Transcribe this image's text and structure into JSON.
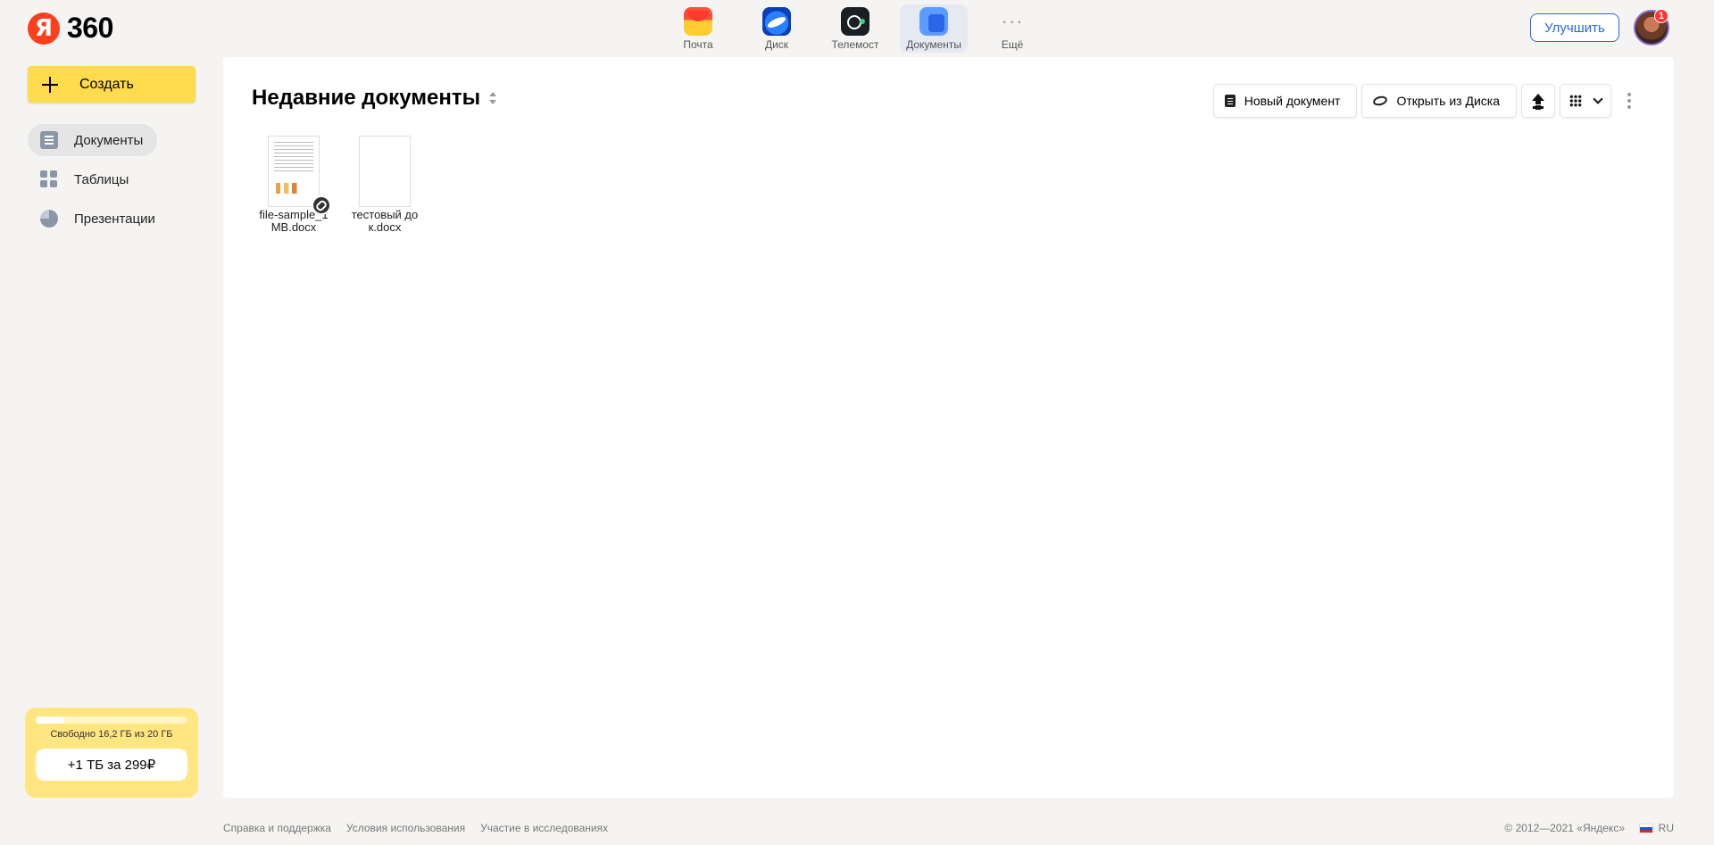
{
  "header": {
    "logo_letter": "Я",
    "logo_text": "360",
    "services": [
      {
        "label": "Почта",
        "icon": "mail-icon"
      },
      {
        "label": "Диск",
        "icon": "disk-icon"
      },
      {
        "label": "Телемост",
        "icon": "telemost-icon"
      },
      {
        "label": "Документы",
        "icon": "documents-icon",
        "active": true
      },
      {
        "label": "Ещё",
        "icon": "more-icon"
      }
    ],
    "upgrade_label": "Улучшить",
    "notification_count": "1"
  },
  "sidebar": {
    "create_label": "Создать",
    "items": [
      {
        "label": "Документы",
        "icon": "document-icon",
        "active": true
      },
      {
        "label": "Таблицы",
        "icon": "spreadsheet-icon"
      },
      {
        "label": "Презентации",
        "icon": "presentation-icon"
      }
    ],
    "storage": {
      "used_fraction": 0.19,
      "info": "Свободно 16,2 ГБ из 20 ГБ",
      "buy_label": "+1 ТБ за 299₽"
    }
  },
  "main": {
    "title": "Недавние документы",
    "toolbar": {
      "new_doc_label": "Новый документ",
      "open_disk_label": "Открыть из Диска"
    },
    "files": [
      {
        "name": "file-sample_1MB.docx",
        "shared": true
      },
      {
        "name": "тестовый док.docx",
        "shared": false
      }
    ]
  },
  "footer": {
    "links": [
      "Справка и поддержка",
      "Условия использования",
      "Участие в исследованиях"
    ],
    "copyright": "© 2012—2021 «Яндекс»",
    "lang": "RU"
  },
  "colors": {
    "create_button": "#ffdb4d",
    "accent": "#2b65e8",
    "brand_red": "#fc3f1d"
  }
}
